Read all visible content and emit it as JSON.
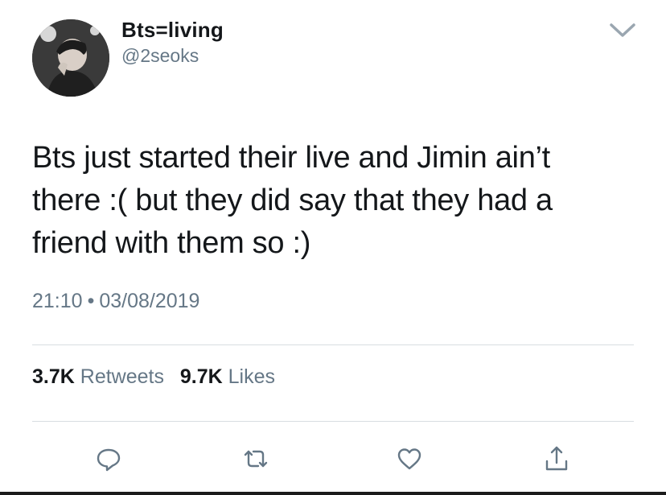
{
  "tweet": {
    "display_name": "Bts=living",
    "handle": "@2seoks",
    "text_lines": [
      "Bts just started their live and Jimin ain’t",
      "there :( but they did say that they had a",
      "friend with them so :)"
    ],
    "time": "21:10",
    "separator": "•",
    "date": "03/08/2019"
  },
  "stats": {
    "retweets_count": "3.7K",
    "retweets_label": "Retweets",
    "likes_count": "9.7K",
    "likes_label": "Likes"
  },
  "actions": {
    "reply_icon": "reply-icon",
    "retweet_icon": "retweet-icon",
    "like_icon": "heart-icon",
    "share_icon": "share-icon"
  },
  "colors": {
    "primary_text": "#14171a",
    "secondary_text": "#657786",
    "divider": "#d8dde1"
  }
}
